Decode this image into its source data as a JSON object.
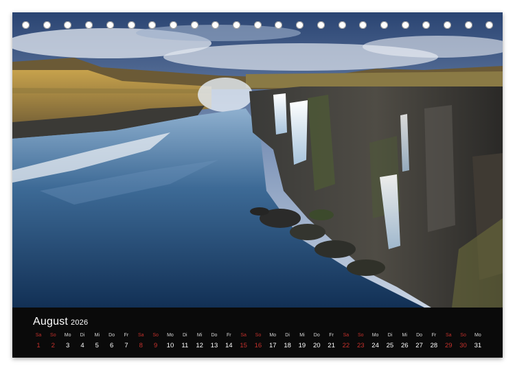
{
  "calendar": {
    "month": "August",
    "year": "2026",
    "weekdays": [
      "Sa",
      "So",
      "Mo",
      "Di",
      "Mi",
      "Do",
      "Fr",
      "Sa",
      "So",
      "Mo",
      "Di",
      "Mi",
      "Do",
      "Fr",
      "Sa",
      "So",
      "Mo",
      "Di",
      "Mi",
      "Do",
      "Fr",
      "Sa",
      "So",
      "Mo",
      "Di",
      "Mi",
      "Do",
      "Fr",
      "Sa",
      "So",
      "Mo"
    ],
    "days": [
      "1",
      "2",
      "3",
      "4",
      "5",
      "6",
      "7",
      "8",
      "9",
      "10",
      "11",
      "12",
      "13",
      "14",
      "15",
      "16",
      "17",
      "18",
      "19",
      "20",
      "21",
      "22",
      "23",
      "24",
      "25",
      "26",
      "27",
      "28",
      "29",
      "30",
      "31"
    ],
    "weekend_days": [
      "1",
      "2",
      "8",
      "9",
      "15",
      "16",
      "22",
      "23",
      "29",
      "30"
    ]
  },
  "colors": {
    "strip_background": "#0a0a0a",
    "weekend_text": "#c5312c",
    "weekday_text": "#ffffff"
  },
  "binding": {
    "ring_count": 23,
    "icon": "spiral-binding-ring"
  },
  "photo": {
    "icon": "waterfall-canyon-photo"
  }
}
